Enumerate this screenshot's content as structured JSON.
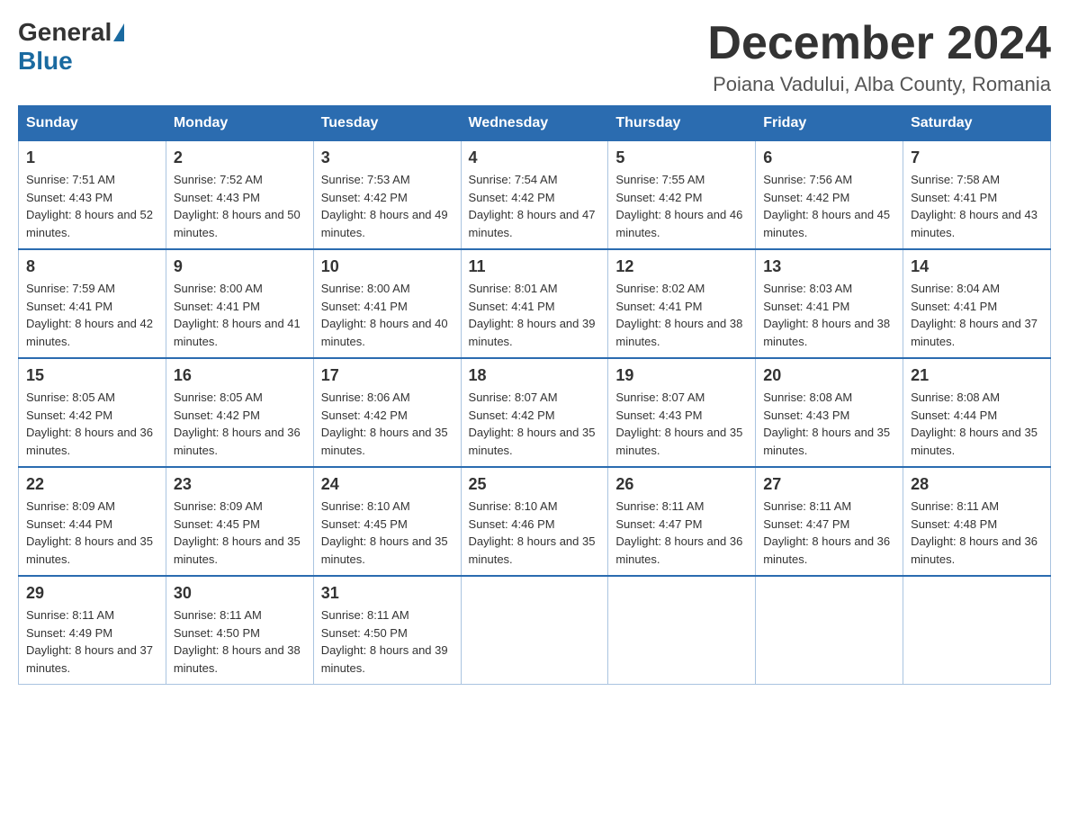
{
  "logo": {
    "general": "General",
    "blue": "Blue"
  },
  "title": {
    "month": "December 2024",
    "location": "Poiana Vadului, Alba County, Romania"
  },
  "days_of_week": [
    "Sunday",
    "Monday",
    "Tuesday",
    "Wednesday",
    "Thursday",
    "Friday",
    "Saturday"
  ],
  "weeks": [
    [
      {
        "day": "1",
        "sunrise": "7:51 AM",
        "sunset": "4:43 PM",
        "daylight": "8 hours and 52 minutes."
      },
      {
        "day": "2",
        "sunrise": "7:52 AM",
        "sunset": "4:43 PM",
        "daylight": "8 hours and 50 minutes."
      },
      {
        "day": "3",
        "sunrise": "7:53 AM",
        "sunset": "4:42 PM",
        "daylight": "8 hours and 49 minutes."
      },
      {
        "day": "4",
        "sunrise": "7:54 AM",
        "sunset": "4:42 PM",
        "daylight": "8 hours and 47 minutes."
      },
      {
        "day": "5",
        "sunrise": "7:55 AM",
        "sunset": "4:42 PM",
        "daylight": "8 hours and 46 minutes."
      },
      {
        "day": "6",
        "sunrise": "7:56 AM",
        "sunset": "4:42 PM",
        "daylight": "8 hours and 45 minutes."
      },
      {
        "day": "7",
        "sunrise": "7:58 AM",
        "sunset": "4:41 PM",
        "daylight": "8 hours and 43 minutes."
      }
    ],
    [
      {
        "day": "8",
        "sunrise": "7:59 AM",
        "sunset": "4:41 PM",
        "daylight": "8 hours and 42 minutes."
      },
      {
        "day": "9",
        "sunrise": "8:00 AM",
        "sunset": "4:41 PM",
        "daylight": "8 hours and 41 minutes."
      },
      {
        "day": "10",
        "sunrise": "8:00 AM",
        "sunset": "4:41 PM",
        "daylight": "8 hours and 40 minutes."
      },
      {
        "day": "11",
        "sunrise": "8:01 AM",
        "sunset": "4:41 PM",
        "daylight": "8 hours and 39 minutes."
      },
      {
        "day": "12",
        "sunrise": "8:02 AM",
        "sunset": "4:41 PM",
        "daylight": "8 hours and 38 minutes."
      },
      {
        "day": "13",
        "sunrise": "8:03 AM",
        "sunset": "4:41 PM",
        "daylight": "8 hours and 38 minutes."
      },
      {
        "day": "14",
        "sunrise": "8:04 AM",
        "sunset": "4:41 PM",
        "daylight": "8 hours and 37 minutes."
      }
    ],
    [
      {
        "day": "15",
        "sunrise": "8:05 AM",
        "sunset": "4:42 PM",
        "daylight": "8 hours and 36 minutes."
      },
      {
        "day": "16",
        "sunrise": "8:05 AM",
        "sunset": "4:42 PM",
        "daylight": "8 hours and 36 minutes."
      },
      {
        "day": "17",
        "sunrise": "8:06 AM",
        "sunset": "4:42 PM",
        "daylight": "8 hours and 35 minutes."
      },
      {
        "day": "18",
        "sunrise": "8:07 AM",
        "sunset": "4:42 PM",
        "daylight": "8 hours and 35 minutes."
      },
      {
        "day": "19",
        "sunrise": "8:07 AM",
        "sunset": "4:43 PM",
        "daylight": "8 hours and 35 minutes."
      },
      {
        "day": "20",
        "sunrise": "8:08 AM",
        "sunset": "4:43 PM",
        "daylight": "8 hours and 35 minutes."
      },
      {
        "day": "21",
        "sunrise": "8:08 AM",
        "sunset": "4:44 PM",
        "daylight": "8 hours and 35 minutes."
      }
    ],
    [
      {
        "day": "22",
        "sunrise": "8:09 AM",
        "sunset": "4:44 PM",
        "daylight": "8 hours and 35 minutes."
      },
      {
        "day": "23",
        "sunrise": "8:09 AM",
        "sunset": "4:45 PM",
        "daylight": "8 hours and 35 minutes."
      },
      {
        "day": "24",
        "sunrise": "8:10 AM",
        "sunset": "4:45 PM",
        "daylight": "8 hours and 35 minutes."
      },
      {
        "day": "25",
        "sunrise": "8:10 AM",
        "sunset": "4:46 PM",
        "daylight": "8 hours and 35 minutes."
      },
      {
        "day": "26",
        "sunrise": "8:11 AM",
        "sunset": "4:47 PM",
        "daylight": "8 hours and 36 minutes."
      },
      {
        "day": "27",
        "sunrise": "8:11 AM",
        "sunset": "4:47 PM",
        "daylight": "8 hours and 36 minutes."
      },
      {
        "day": "28",
        "sunrise": "8:11 AM",
        "sunset": "4:48 PM",
        "daylight": "8 hours and 36 minutes."
      }
    ],
    [
      {
        "day": "29",
        "sunrise": "8:11 AM",
        "sunset": "4:49 PM",
        "daylight": "8 hours and 37 minutes."
      },
      {
        "day": "30",
        "sunrise": "8:11 AM",
        "sunset": "4:50 PM",
        "daylight": "8 hours and 38 minutes."
      },
      {
        "day": "31",
        "sunrise": "8:11 AM",
        "sunset": "4:50 PM",
        "daylight": "8 hours and 39 minutes."
      },
      null,
      null,
      null,
      null
    ]
  ]
}
